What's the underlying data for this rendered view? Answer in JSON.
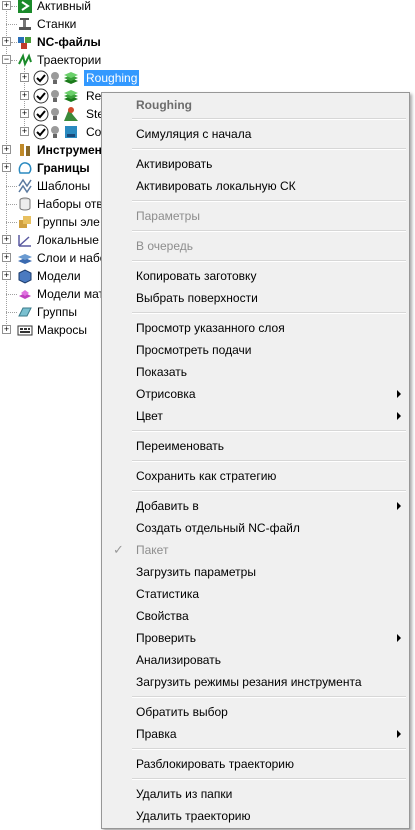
{
  "tree": {
    "items": [
      {
        "label": "Активный",
        "bold": false
      },
      {
        "label": "Станки",
        "bold": false
      },
      {
        "label": "NC-файлы",
        "bold": true
      },
      {
        "label": "Траектории",
        "bold": false
      },
      {
        "label": "Roughing",
        "bold": false,
        "selected": true
      },
      {
        "label": "Re",
        "bold": false
      },
      {
        "label": "Ste",
        "bold": false
      },
      {
        "label": "Co",
        "bold": false
      },
      {
        "label": "Инструмент",
        "bold": true
      },
      {
        "label": "Границы",
        "bold": true
      },
      {
        "label": "Шаблоны",
        "bold": false
      },
      {
        "label": "Наборы отв",
        "bold": false
      },
      {
        "label": "Группы эле",
        "bold": false
      },
      {
        "label": "Локальные",
        "bold": false
      },
      {
        "label": "Слои и набо",
        "bold": false
      },
      {
        "label": "Модели",
        "bold": false
      },
      {
        "label": "Модели мат",
        "bold": false
      },
      {
        "label": "Группы",
        "bold": false
      },
      {
        "label": "Макросы",
        "bold": false
      }
    ]
  },
  "menu": {
    "header": "Roughing",
    "items": {
      "sim": "Симуляция с начала",
      "activate": "Активировать",
      "activate_cs": "Активировать локальную СК",
      "params": "Параметры",
      "queue": "В очередь",
      "copy_stock": "Копировать заготовку",
      "select_surfaces": "Выбрать поверхности",
      "view_layer": "Просмотр указанного слоя",
      "view_feeds": "Просмотреть подачи",
      "show": "Показать",
      "draw": "Отрисовка",
      "color": "Цвет",
      "rename": "Переименовать",
      "save_strategy": "Сохранить как стратегию",
      "add_to": "Добавить в",
      "create_nc": "Создать отдельный NC-файл",
      "batch": "Пакет",
      "load_params": "Загрузить параметры",
      "stats": "Статистика",
      "props": "Свойства",
      "verify": "Проверить",
      "analyze": "Анализировать",
      "load_cutting": "Загрузить режимы резания инструмента",
      "invert": "Обратить выбор",
      "edit": "Правка",
      "unlock": "Разблокировать траекторию",
      "remove_folder": "Удалить из папки",
      "delete": "Удалить траекторию"
    },
    "check_glyph": "✓"
  },
  "colors": {
    "selection": "#3399ff",
    "menu_bg": "#f0f0f0",
    "disabled": "#8d8d8d"
  }
}
